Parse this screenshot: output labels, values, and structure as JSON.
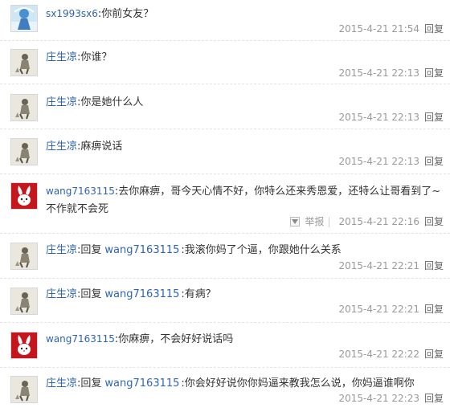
{
  "colors": {
    "username": "#2d64b3",
    "body_text": "#333333",
    "meta_text": "#999999",
    "reply_link": "#666666"
  },
  "reply_label": "回复",
  "report_label": "举报",
  "separator": "|",
  "comments": [
    {
      "avatar": "blue-figure-avatar",
      "user": "sx1993sx6",
      "colon": ":",
      "text": "你前女友？",
      "time": "2015-4-21 21:54",
      "reply": "回复"
    },
    {
      "avatar": "sketch-figure-avatar",
      "user": "庄生凉",
      "colon": ":",
      "text": "你谁？",
      "time": "2015-4-21 22:13",
      "reply": "回复"
    },
    {
      "avatar": "sketch-figure-avatar",
      "user": "庄生凉",
      "colon": ":",
      "text": "你是她什么人",
      "time": "2015-4-21 22:13",
      "reply": "回复"
    },
    {
      "avatar": "sketch-figure-avatar",
      "user": "庄生凉",
      "colon": ":",
      "text": "麻痹说话",
      "time": "2015-4-21 22:13",
      "reply": "回复"
    },
    {
      "avatar": "rabbit-avatar",
      "user": "wang7163115",
      "colon": ":",
      "text": "去你麻痹，哥今天心情不好，你特么还来秀恩爱，还特么让哥看到了~不作就不会死",
      "time": "2015-4-21 22:16",
      "reply": "回复",
      "report": "举报"
    },
    {
      "avatar": "sketch-figure-avatar",
      "user": "庄生凉",
      "colon": ":",
      "reply_word": "回复",
      "target": "wang7163115",
      "text": ":我滚你妈了个逼，你跟她什么关系",
      "time": "2015-4-21 22:21",
      "reply": "回复"
    },
    {
      "avatar": "sketch-figure-avatar",
      "user": "庄生凉",
      "colon": ":",
      "reply_word": "回复",
      "target": "wang7163115",
      "text": ":有病？",
      "time": "2015-4-21 22:21",
      "reply": "回复"
    },
    {
      "avatar": "rabbit-avatar",
      "user": "wang7163115",
      "colon": ":",
      "text": "你麻痹，不会好好说话吗",
      "time": "2015-4-21 22:22",
      "reply": "回复"
    },
    {
      "avatar": "sketch-figure-avatar",
      "user": "庄生凉",
      "colon": ":",
      "reply_word": "回复",
      "target": "wang7163115",
      "text": ":你会好好说你你妈逼来教我怎么说，你妈逼谁啊你",
      "time": "2015-4-21 22:23",
      "reply": "回复"
    }
  ]
}
